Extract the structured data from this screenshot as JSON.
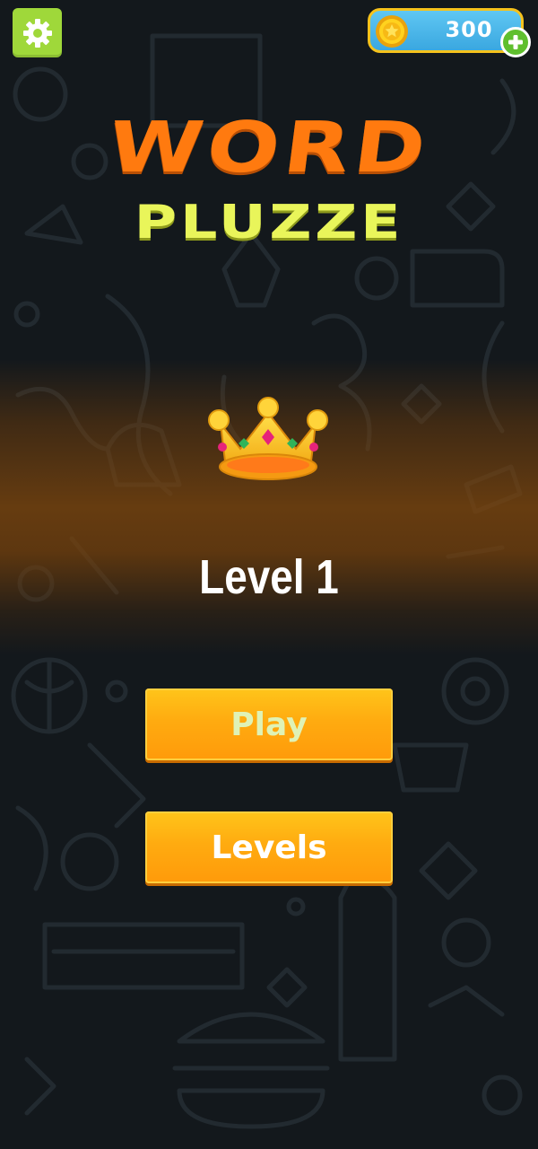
{
  "top_bar": {
    "settings_icon": "gear-icon",
    "coins": "300",
    "coin_icon": "coin-icon",
    "add_coins_icon": "plus-icon"
  },
  "title": {
    "line1": "WORD",
    "line2": "PLUZZE"
  },
  "level": {
    "icon": "crown-icon",
    "label": "Level 1"
  },
  "menu": {
    "play_label": "Play",
    "levels_label": "Levels"
  },
  "colors": {
    "background": "#13181c",
    "title_orange": "#ff7a0f",
    "title_yellow": "#e9f55a",
    "button_orange": "#ffab10",
    "settings_green": "#9fd83a",
    "coin_panel_blue": "#3aa7e0"
  }
}
